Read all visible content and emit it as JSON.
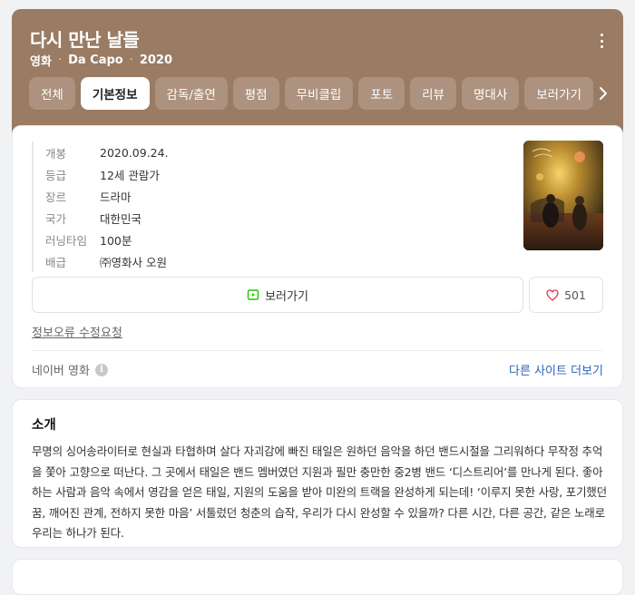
{
  "header": {
    "title": "다시 만난 날들",
    "meta": [
      "영화",
      "Da Capo",
      "2020"
    ],
    "background": "#9a7b63",
    "more_icon": "more-vertical-icon",
    "tabs": [
      {
        "label": "전체",
        "active": false
      },
      {
        "label": "기본정보",
        "active": true
      },
      {
        "label": "감독/출연",
        "active": false
      },
      {
        "label": "평점",
        "active": false
      },
      {
        "label": "무비클립",
        "active": false
      },
      {
        "label": "포토",
        "active": false
      },
      {
        "label": "리뷰",
        "active": false
      },
      {
        "label": "명대사",
        "active": false
      },
      {
        "label": "보러가기",
        "active": false
      }
    ],
    "next_icon": "chevron-right-icon"
  },
  "info": {
    "rows": [
      {
        "key": "개봉",
        "value": "2020.09.24."
      },
      {
        "key": "등급",
        "value": "12세 관람가"
      },
      {
        "key": "장르",
        "value": "드라마"
      },
      {
        "key": "국가",
        "value": "대한민국"
      },
      {
        "key": "러닝타임",
        "value": "100분"
      },
      {
        "key": "배급",
        "value": "㈜영화사 오원"
      }
    ],
    "watch_label": "보러가기",
    "watch_icon": "play-screen-icon",
    "like_count": "501",
    "like_icon": "heart-icon",
    "report_label": "정보오류 수정요청",
    "source_label": "네이버 영화",
    "source_icon": "info-icon",
    "other_sites_label": "다른 사이트 더보기",
    "link_color": "#2f5fb8"
  },
  "intro": {
    "heading": "소개",
    "text": "무명의 싱어송라이터로 현실과 타협하며 살다 자괴감에 빠진 태일은 원하던 음악을 하던 밴드시절을 그리워하다 무작정 추억을 쫓아 고향으로 떠난다. 그 곳에서 태일은 밴드 멤버였던 지원과 필만 충만한 중2병 밴드 ‘디스트리어’를 만나게 된다. 좋아하는 사람과 음악 속에서 영감을 얻은 태일, 지원의 도움을 받아 미완의 트랙을 완성하게 되는데! ‘이루지 못한 사랑, 포기했던 꿈, 깨어진 관계, 전하지 못한 마음’ 서툴렀던 청춘의 습작, 우리가 다시 완성할 수 있을까? 다른 시간, 다른 공간, 같은 노래로 우리는 하나가 된다."
  }
}
